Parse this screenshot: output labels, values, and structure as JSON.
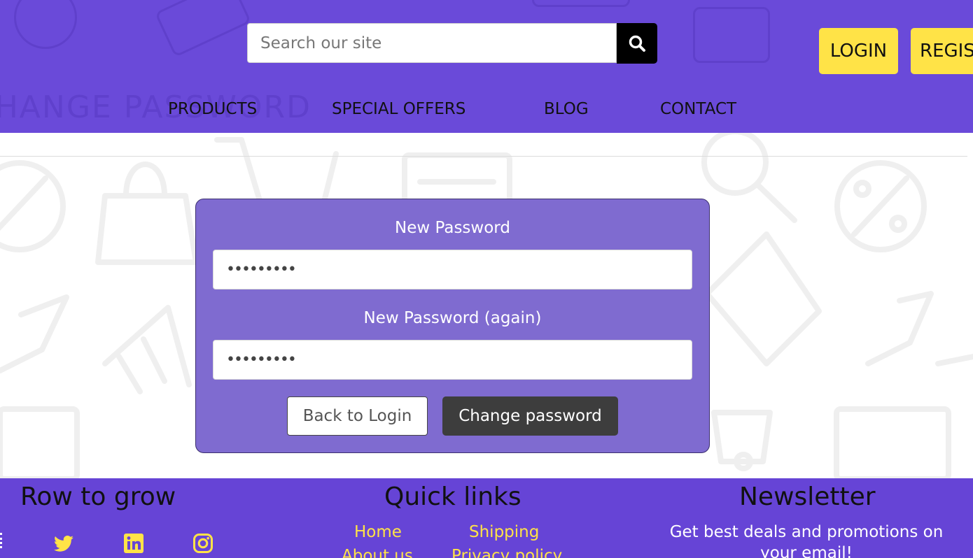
{
  "header": {
    "background_text": "CHANGE PASSWORD",
    "search": {
      "placeholder": "Search our site",
      "icon": "search-icon"
    },
    "login_label": "LOGIN",
    "register_label": "REGISTER",
    "nav": [
      {
        "label": "PRODUCTS"
      },
      {
        "label": "SPECIAL OFFERS"
      },
      {
        "label": "BLOG"
      },
      {
        "label": "CONTACT"
      }
    ]
  },
  "form": {
    "new_password_label": "New Password",
    "new_password_value": "•••••••••",
    "new_password_again_label": "New Password (again)",
    "new_password_again_value": "•••••••••",
    "back_button": "Back to Login",
    "submit_button": "Change password"
  },
  "footer": {
    "brand_heading": "Row to grow",
    "social": [
      "twitter-icon",
      "linkedin-icon",
      "instagram-icon"
    ],
    "quick_links_heading": "Quick links",
    "quick_links": [
      "Home",
      "Shipping",
      "About us",
      "Privacy policy"
    ],
    "newsletter_heading": "Newsletter",
    "newsletter_text": "Get best deals and promotions on your email!"
  },
  "colors": {
    "header_bg": "#6a4ad9",
    "footer_bg": "#6644d6",
    "card_bg": "#7f6bd0",
    "accent_yellow": "#ffe347",
    "dark_button": "#3d3d3d"
  }
}
